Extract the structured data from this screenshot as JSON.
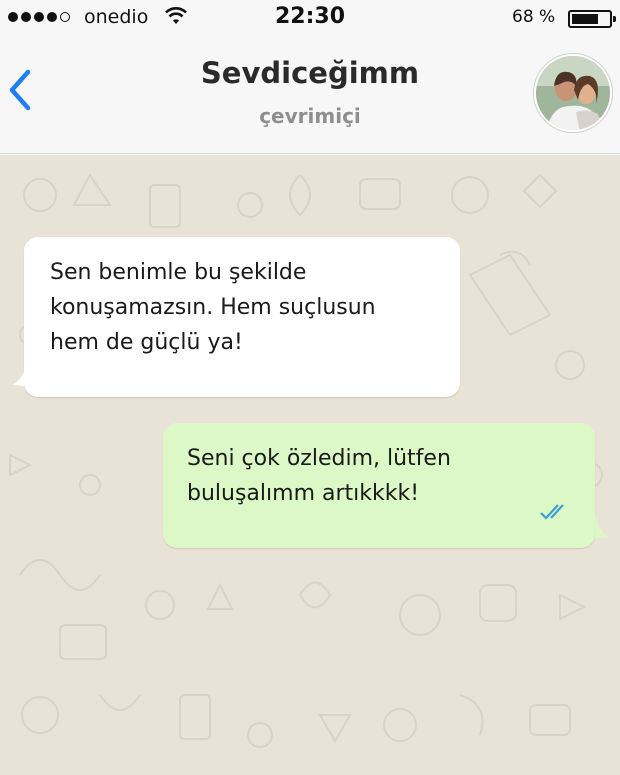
{
  "status_bar": {
    "carrier": "onedio",
    "time": "22:30",
    "battery_percent": "68 %",
    "battery_level": 0.68,
    "signal_bars": 4,
    "signal_total": 5
  },
  "header": {
    "contact_name": "Sevdiceğimm",
    "status": "çevrimiçi"
  },
  "messages": [
    {
      "direction": "incoming",
      "text": "Sen benimle bu şekilde\nkonuşamazsın. Hem suçlusun\nhem de güçlü ya!"
    },
    {
      "direction": "outgoing",
      "text": "Seni çok özledim, lütfen\nbuluşalımm artıkkkk!",
      "read_receipt": "double-check-icon"
    }
  ],
  "colors": {
    "accent": "#1d7ef5",
    "incoming_bubble": "#ffffff",
    "outgoing_bubble": "#dcf8c6",
    "chat_background": "#e9e2d6",
    "tick_color": "#3aa0d8"
  }
}
